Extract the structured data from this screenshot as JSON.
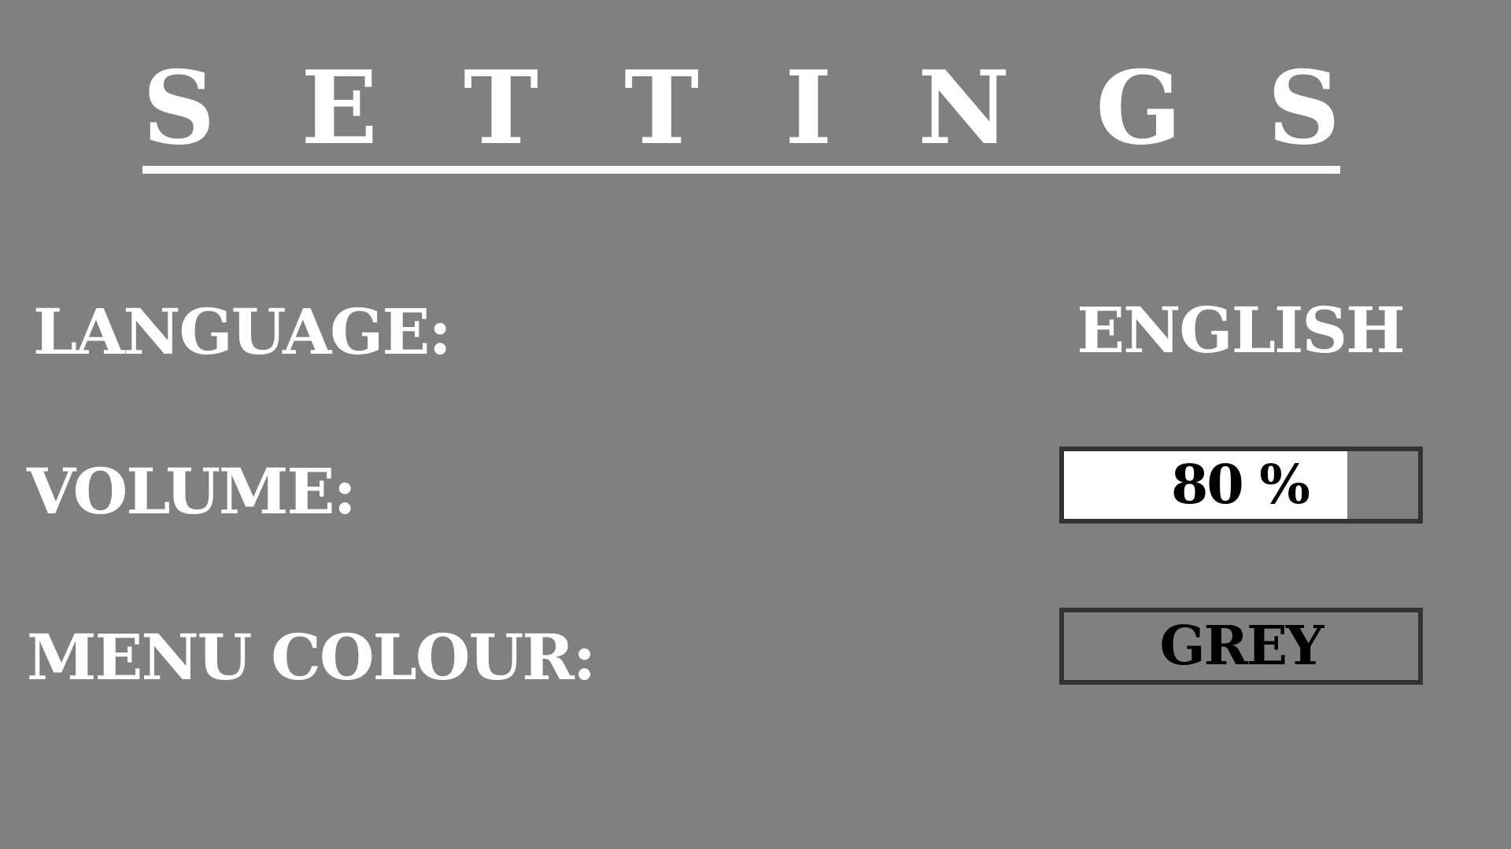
{
  "colors": {
    "background": "#808080",
    "text": "#ffffff",
    "box_border": "#333333",
    "box_text": "#000000",
    "volume_fill": "#ffffff"
  },
  "header": {
    "title_letters": [
      "S",
      "E",
      "T",
      "T",
      "I",
      "N",
      "G",
      "S"
    ]
  },
  "settings": {
    "language": {
      "label": "LANGUAGE:",
      "value": "ENGLISH"
    },
    "volume": {
      "label": "VOLUME:",
      "value_text": "80 %",
      "level": 0.8
    },
    "menu_colour": {
      "label": "MENU COLOUR:",
      "value": "GREY"
    }
  }
}
